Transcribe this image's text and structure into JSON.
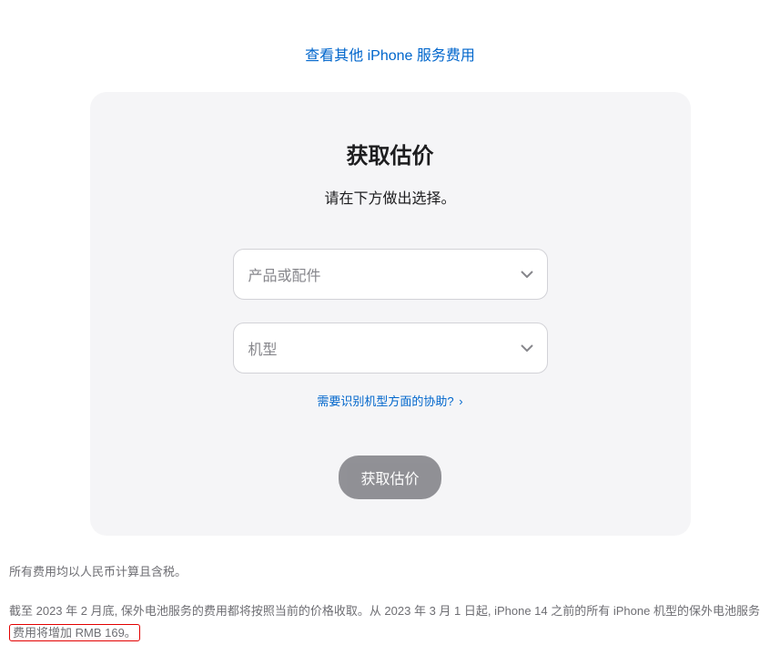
{
  "topLink": {
    "label": "查看其他 iPhone 服务费用"
  },
  "card": {
    "title": "获取估价",
    "subtitle": "请在下方做出选择。",
    "select1": {
      "placeholder": "产品或配件"
    },
    "select2": {
      "placeholder": "机型"
    },
    "helpLink": {
      "label": "需要识别机型方面的协助?",
      "chevron": "›"
    },
    "submitButton": {
      "label": "获取估价"
    }
  },
  "footer": {
    "line1": "所有费用均以人民币计算且含税。",
    "line2_part1": "截至 2023 年 2 月底, 保外电池服务的费用都将按照当前的价格收取。从 2023 年 3 月 1 日起, iPhone 14 之前的所有 iPhone 机型的保外电池服务",
    "line2_highlight": "费用将增加 RMB 169。"
  }
}
